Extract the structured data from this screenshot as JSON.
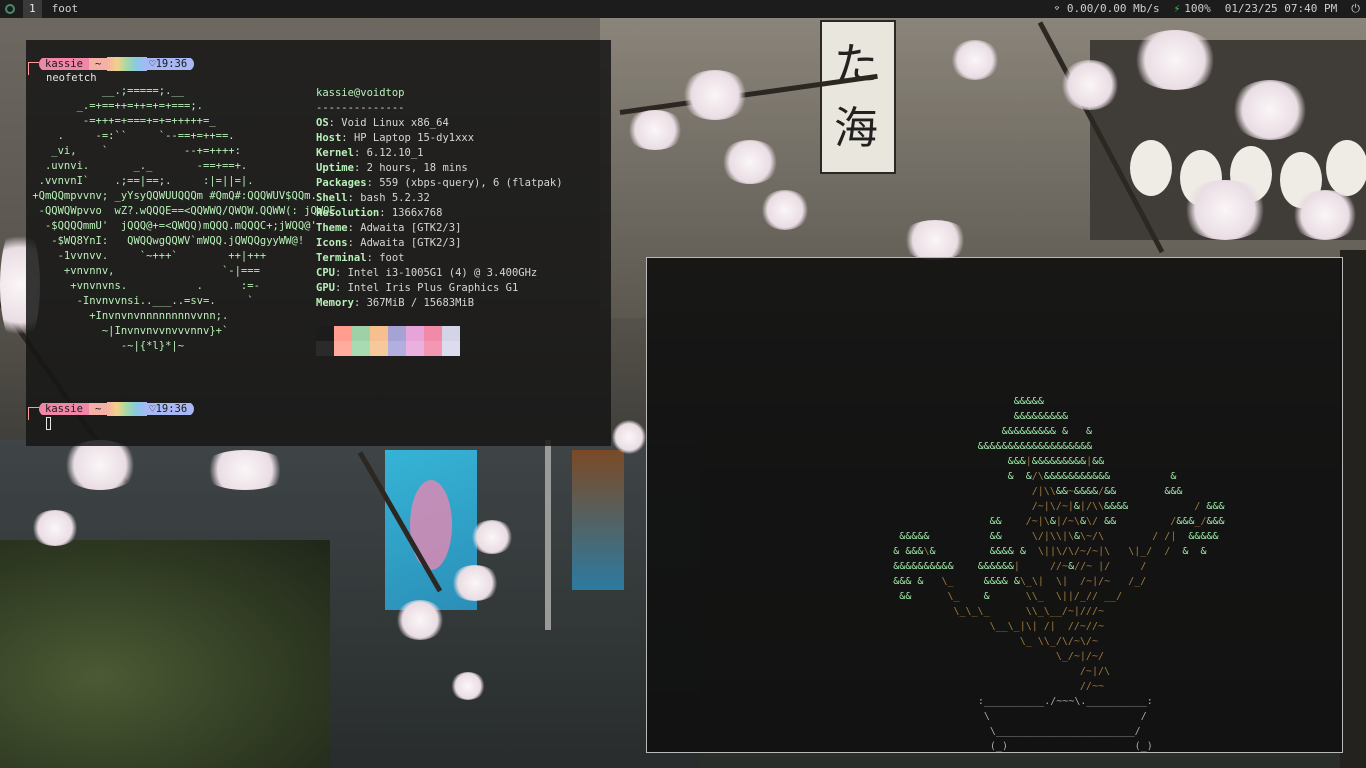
{
  "topbar": {
    "workspace": "1",
    "window_title": "foot",
    "network": "0.00/0.00 Mb/s",
    "battery": "100%",
    "datetime": "01/23/25 07:40 PM"
  },
  "terminal1": {
    "prompt_user": "kassie",
    "prompt_dir": "~",
    "prompt_time_1": "19:36",
    "command": "neofetch",
    "prompt_time_2": "19:36",
    "ascii_logo": "            __.;=====;.__\n        _.=+==++=++=+=+===;.\n         -=+++=+===+=+=+++++=_\n     .     -=:``     `--==+=++==.\n    _vi,    `            --+=++++:\n   .uvnvi.       _._       -==+==+.\n  .vvnvnI`    .;==|==;.     :|=||=|.\n +QmQQmpvvnv; _yYsyQQWUUQQQm #QmQ#:QQQWUV$QQm.\n  -QQWQWpvvo  wZ?.wQQQE==<QQWWQ/QWQW.QQWW(: jQWQE\n   -$QQQQmmU'  jQQQ@+=<QWQQ)mQQQ.mQQQC+;jWQQ@'\n    -$WQ8YnI:   QWQQwgQQWV`mWQQ.jQWQQgyyWW@!\n     -1vvnvv.     `~+++`        ++|+++\n      +vnvnnv,                 `-|===\n       +vnvnvns.           .      :=-\n        -Invnvvnsi..___..=sv=.     `\n          +Invnvnvnnnnnnnnvvnn;.\n            ~|Invnvnvvnvvvnnv}+`\n               -~|{*l}*|~",
    "info_header": "kassie@voidtop",
    "info_separator": "--------------",
    "info": [
      {
        "key": "OS",
        "value": ": Void Linux x86_64"
      },
      {
        "key": "Host",
        "value": ": HP Laptop 15-dy1xxx"
      },
      {
        "key": "Kernel",
        "value": ": 6.12.10_1"
      },
      {
        "key": "Uptime",
        "value": ": 2 hours, 18 mins"
      },
      {
        "key": "Packages",
        "value": ": 559 (xbps-query), 6 (flatpak)"
      },
      {
        "key": "Shell",
        "value": ": bash 5.2.32"
      },
      {
        "key": "Resolution",
        "value": ": 1366x768"
      },
      {
        "key": "Theme",
        "value": ": Adwaita [GTK2/3]"
      },
      {
        "key": "Icons",
        "value": ": Adwaita [GTK2/3]"
      },
      {
        "key": "Terminal",
        "value": ": foot"
      },
      {
        "key": "CPU",
        "value": ": Intel i3-1005G1 (4) @ 3.400GHz"
      },
      {
        "key": "GPU",
        "value": ": Intel Iris Plus Graphics G1"
      },
      {
        "key": "Memory",
        "value": ": 367MiB / 15683MiB"
      }
    ],
    "palette_top": [
      "#1c1c1c",
      "#ff9e8e",
      "#9fd1a8",
      "#f5c08e",
      "#a7a2d4",
      "#e6a4d8",
      "#f08aa8",
      "#d4d4e8"
    ],
    "palette_bottom": [
      "#2a2a2a",
      "#ffab9d",
      "#a8dbb2",
      "#f6c99c",
      "#b3aee0",
      "#eab0de",
      "#f497b3",
      "#dcdcee"
    ]
  },
  "terminal2": {
    "bonsai_lines": [
      "                                 &&&&&",
      "                                 &&&&&&&&&",
      "                               &&&&&&&&& &   &",
      "                           &&&&&&&&&&&&&&&&&&&",
      "                                &&&|&&&&&&&&&|&&",
      "                                &  &/\\&&&&&&&&&&&          &",
      "                                    /|\\\\&&~&&&&/&&        &&&",
      "                                    /~|\\/~|&|/\\\\&&&&           / &&&",
      "                             &&    /~|\\&|/~\\&\\/ &&         /&&&_/&&&",
      "              &&&&&          &&     \\/|\\\\|\\&\\~/\\        / /|  &&&&&",
      "             & &&&\\&         &&&& &  \\||\\/\\/~/~|\\   \\|_/  /  &  &",
      "             &&&&&&&&&&    &&&&&&|     //~&//~ |/     /",
      "             &&& &   \\_     &&&& &\\_\\|  \\|  /~|/~   /_/",
      "              &&      \\_    &      \\\\_  \\||/_// __/",
      "                       \\_\\_\\_      \\\\_\\__/~|///~",
      "                             \\__\\_|\\| /|  //~//~",
      "                                  \\_ \\\\_/\\/~\\/~",
      "                                        \\_/~|/~/",
      "                                            /~|/\\",
      "                                            //~~",
      "                           :__________./~~~\\.__________:",
      "                            \\                         /",
      "                             \\_______________________/",
      "                             (_)                     (_)"
    ]
  }
}
